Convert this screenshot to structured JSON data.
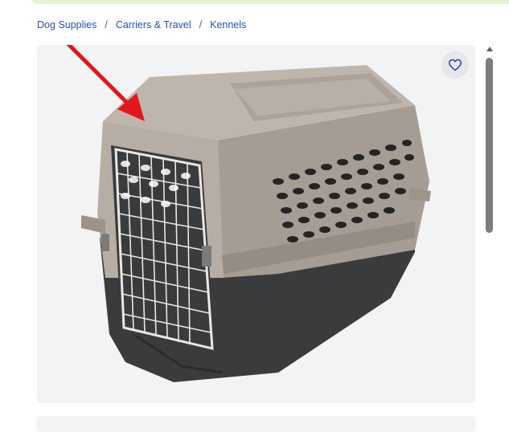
{
  "breadcrumb": {
    "items": [
      {
        "label": "Dog Supplies"
      },
      {
        "label": "Carriers & Travel"
      },
      {
        "label": "Kennels"
      }
    ],
    "separator": "/"
  },
  "product_image": {
    "subject": "plastic pet kennel with wire door",
    "favorite_icon": "heart-icon",
    "annotation": "red-arrow"
  },
  "colors": {
    "link": "#2a4fb5",
    "arrow": "#e3161c",
    "kennel_top": "#a49c92",
    "kennel_base": "#3a3b3d"
  }
}
